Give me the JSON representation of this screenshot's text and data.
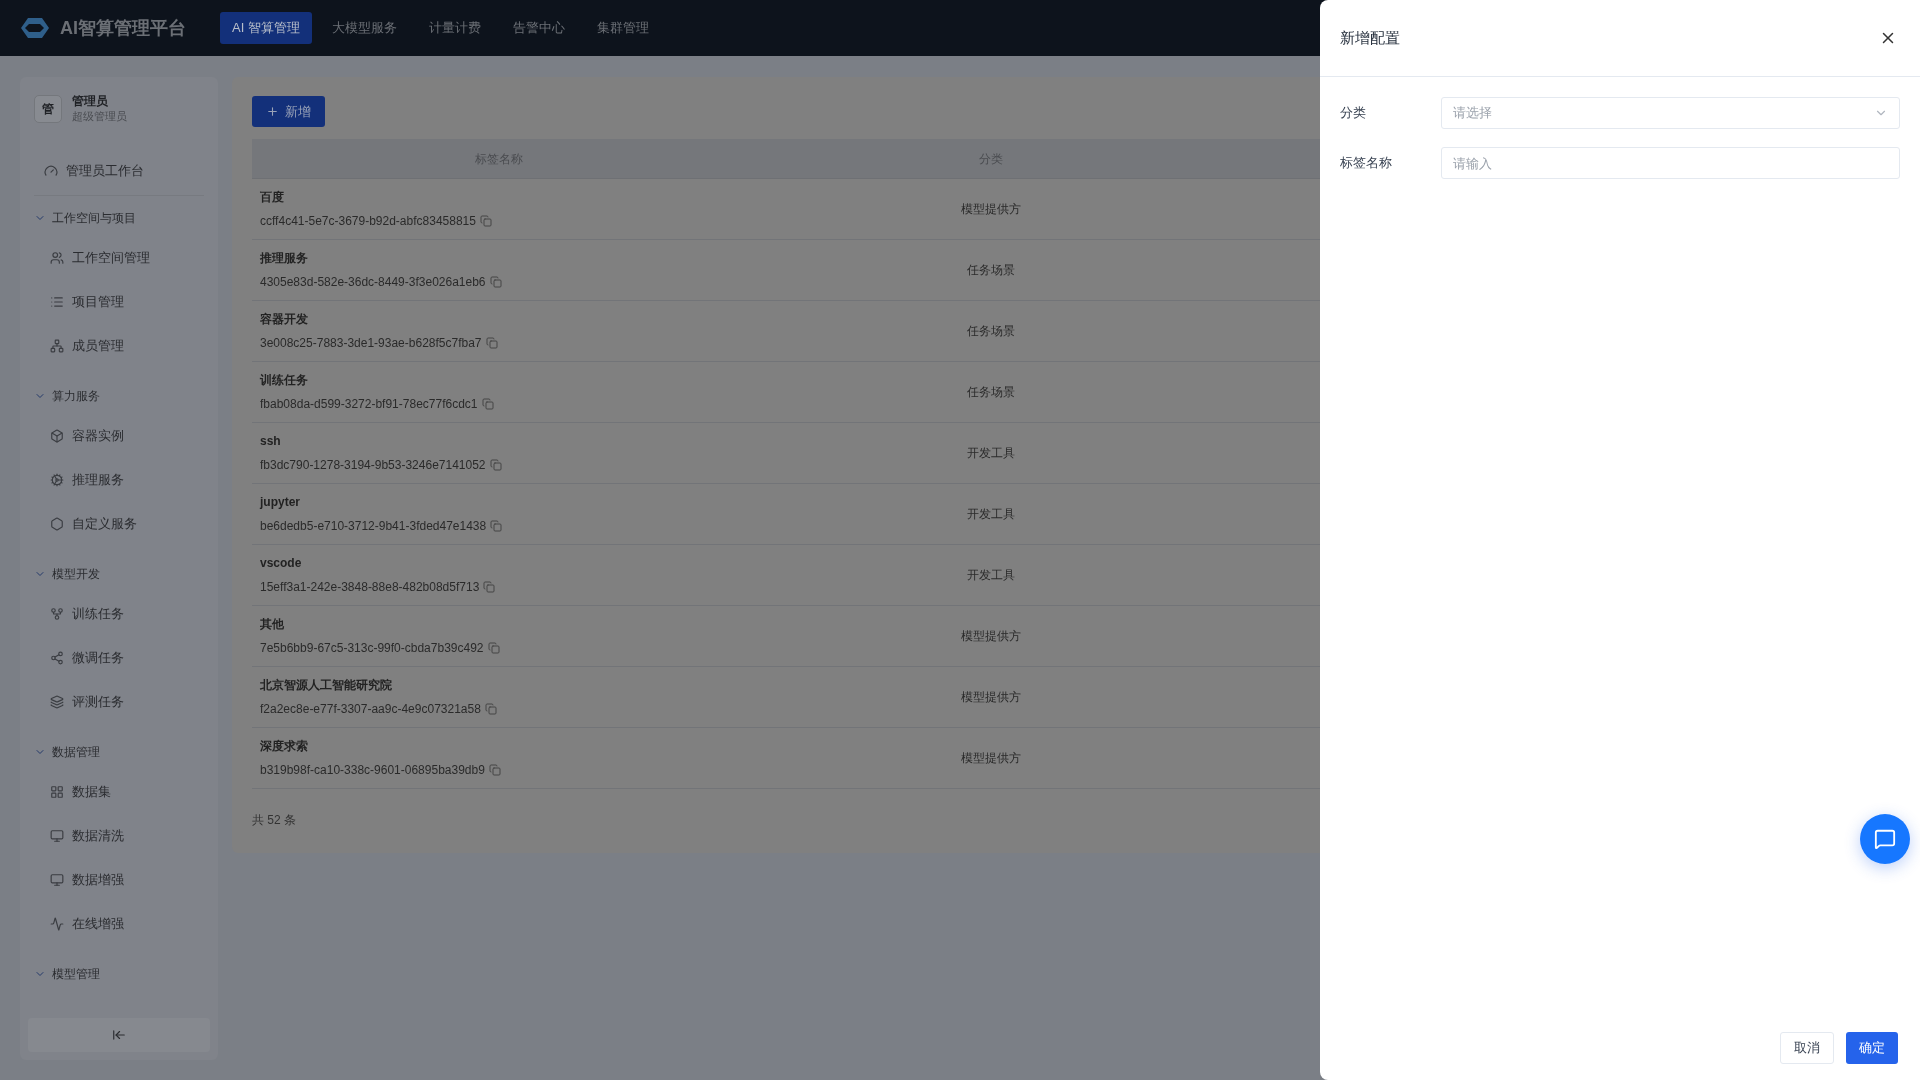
{
  "header": {
    "brand": "AI智算管理平台",
    "tabs": [
      {
        "label": "AI 智算管理",
        "selected": true
      },
      {
        "label": "大模型服务",
        "selected": false
      },
      {
        "label": "计量计费",
        "selected": false
      },
      {
        "label": "告警中心",
        "selected": false
      },
      {
        "label": "集群管理",
        "selected": false
      }
    ]
  },
  "sidebar": {
    "user": {
      "avatar": "管",
      "name": "管理员",
      "role": "超级管理员"
    },
    "home": {
      "label": "管理员工作台"
    },
    "groups": [
      {
        "label": "工作空间与项目",
        "expanded": true,
        "children": [
          {
            "label": "工作空间管理"
          },
          {
            "label": "项目管理"
          },
          {
            "label": "成员管理"
          }
        ]
      },
      {
        "label": "算力服务",
        "expanded": true,
        "children": [
          {
            "label": "容器实例"
          },
          {
            "label": "推理服务"
          },
          {
            "label": "自定义服务"
          }
        ]
      },
      {
        "label": "模型开发",
        "expanded": true,
        "children": [
          {
            "label": "训练任务"
          },
          {
            "label": "微调任务"
          },
          {
            "label": "评测任务"
          }
        ]
      },
      {
        "label": "数据管理",
        "expanded": true,
        "children": [
          {
            "label": "数据集"
          },
          {
            "label": "数据清洗"
          },
          {
            "label": "数据增强"
          },
          {
            "label": "在线增强"
          }
        ]
      },
      {
        "label": "模型管理",
        "expanded": true
      }
    ]
  },
  "toolbar": {
    "add_button": "新增"
  },
  "table": {
    "columns": [
      "标签名称",
      "分类"
    ],
    "rows": [
      {
        "name": "百度",
        "id": "ccff4c41-5e7c-3679-b92d-abfc83458815",
        "category": "模型提供方"
      },
      {
        "name": "推理服务",
        "id": "4305e83d-582e-36dc-8449-3f3e026a1eb6",
        "category": "任务场景"
      },
      {
        "name": "容器开发",
        "id": "3e008c25-7883-3de1-93ae-b628f5c7fba7",
        "category": "任务场景"
      },
      {
        "name": "训练任务",
        "id": "fbab08da-d599-3272-bf91-78ec77f6cdc1",
        "category": "任务场景"
      },
      {
        "name": "ssh",
        "id": "fb3dc790-1278-3194-9b53-3246e7141052",
        "category": "开发工具"
      },
      {
        "name": "jupyter",
        "id": "be6dedb5-e710-3712-9b41-3fded47e1438",
        "category": "开发工具"
      },
      {
        "name": "vscode",
        "id": "15eff3a1-242e-3848-88e8-482b08d5f713",
        "category": "开发工具"
      },
      {
        "name": "其他",
        "id": "7e5b6bb9-67c5-313c-99f0-cbda7b39c492",
        "category": "模型提供方"
      },
      {
        "name": "北京智源人工智能研究院",
        "id": "f2a2ec8e-e77f-3307-aa9c-4e9c07321a58",
        "category": "模型提供方"
      },
      {
        "name": "深度求索",
        "id": "b319b98f-ca10-338c-9601-06895ba39db9",
        "category": "模型提供方"
      }
    ],
    "total": "共 52 条"
  },
  "drawer": {
    "title": "新增配置",
    "fields": [
      {
        "label": "分类",
        "kind": "select",
        "placeholder": "请选择"
      },
      {
        "label": "标签名称",
        "kind": "input",
        "placeholder": "请输入"
      }
    ],
    "buttons": [
      {
        "label": "取消",
        "kind": "secondary"
      },
      {
        "label": "确定",
        "kind": "primary"
      }
    ]
  }
}
